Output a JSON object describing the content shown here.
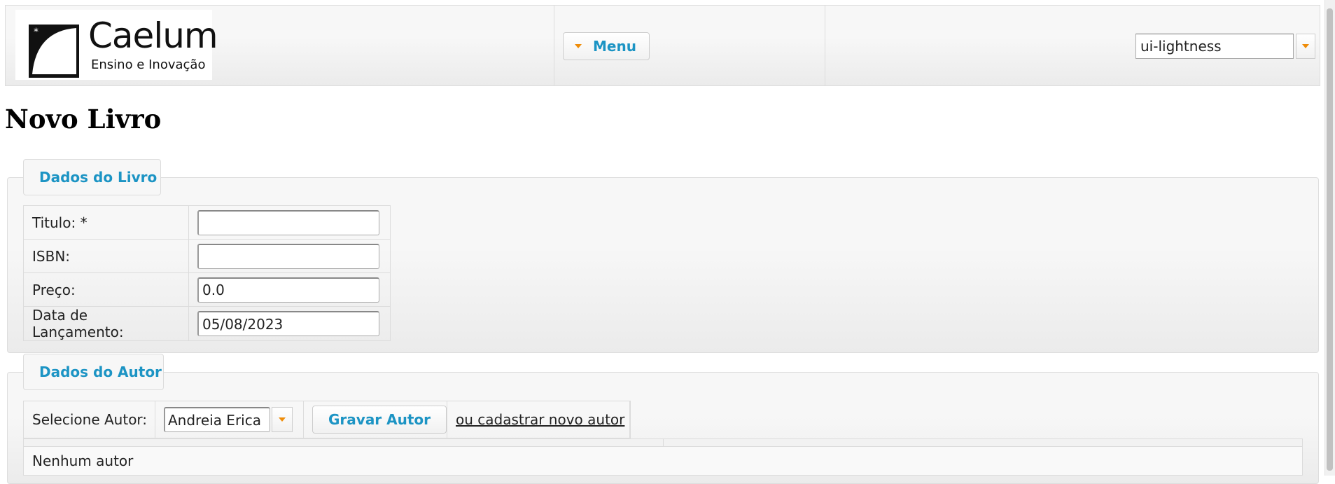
{
  "header": {
    "logo": {
      "brand": "Caelum",
      "tagline": "Ensino e Inovação"
    },
    "menu_label": "Menu",
    "theme": {
      "value": "ui-lightness"
    }
  },
  "page_title": "Novo Livro",
  "book_section": {
    "legend": "Dados do Livro",
    "fields": [
      {
        "label": "Titulo: *",
        "value": ""
      },
      {
        "label": "ISBN:",
        "value": ""
      },
      {
        "label": "Preço:",
        "value": "0.0"
      },
      {
        "label": "Data de Lançamento:",
        "value": "05/08/2023"
      }
    ]
  },
  "author_section": {
    "legend": "Dados do Autor",
    "select_label": "Selecione Autor:",
    "selected_author": "Andreia Erica",
    "save_button": "Gravar Autor",
    "new_author_link": "ou cadastrar novo autor",
    "empty_message": "Nenhum autor"
  },
  "colors": {
    "accent": "#1c94c4",
    "arrow": "#ef8c08",
    "border": "#dcdcdc"
  },
  "icons": [
    "caelum-logo-icon",
    "dropdown-arrow-icon"
  ]
}
